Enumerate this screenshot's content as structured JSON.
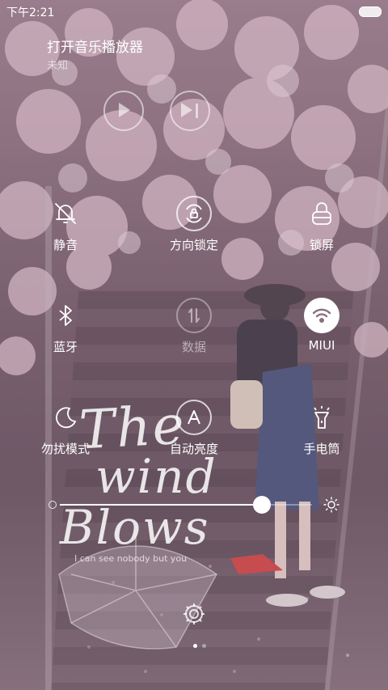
{
  "status_bar": {
    "time": "下午2:21"
  },
  "music": {
    "title": "打开音乐播放器",
    "subtitle": "未知"
  },
  "toggles": [
    {
      "label": "静音",
      "icon": "bell-mute-icon",
      "active": false
    },
    {
      "label": "方向锁定",
      "icon": "rotation-lock-icon",
      "active": false
    },
    {
      "label": "锁屏",
      "icon": "lock-icon",
      "active": false
    },
    {
      "label": "蓝牙",
      "icon": "bluetooth-icon",
      "active": false
    },
    {
      "label": "数据",
      "icon": "mobile-data-icon",
      "active": false
    },
    {
      "label": "MIUI",
      "icon": "wifi-icon",
      "active": true
    },
    {
      "label": "勿扰模式",
      "icon": "moon-icon",
      "active": false
    },
    {
      "label": "自动亮度",
      "icon": "auto-brightness-icon",
      "active": false
    },
    {
      "label": "手电筒",
      "icon": "flashlight-icon",
      "active": false
    }
  ],
  "brightness": {
    "level": 0.8
  },
  "wallpaper": {
    "line1": "The",
    "line2": "wind",
    "line3": "Blows",
    "tagline": "I can see nobody but you"
  },
  "page_indicator": {
    "pages": 2,
    "current": 1
  },
  "colors": {
    "active_toggle": "#ffffff",
    "active_icon": "#8a7080"
  }
}
